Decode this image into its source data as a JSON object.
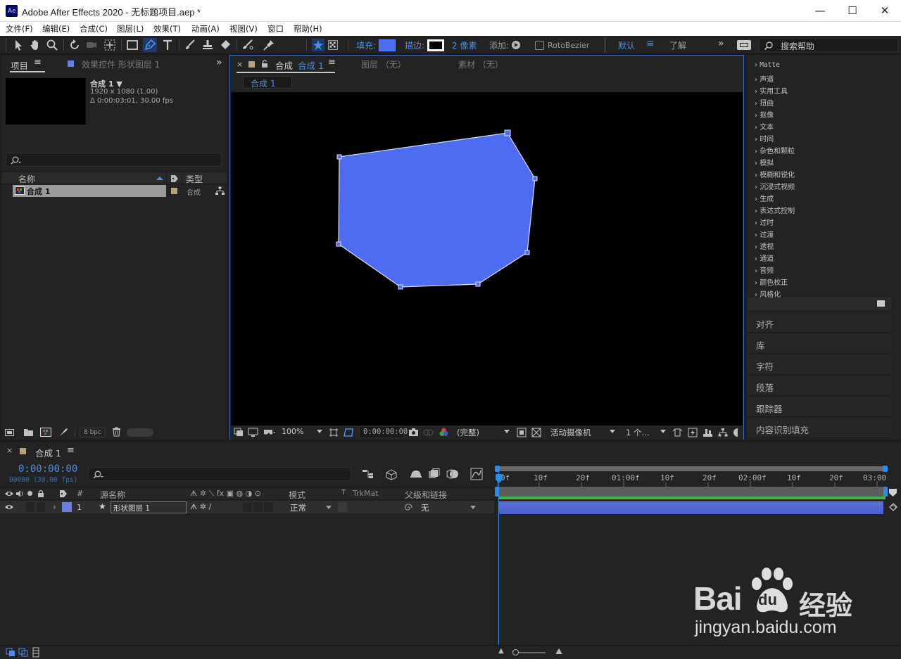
{
  "window": {
    "app_icon": "Ae",
    "title": "Adobe After Effects 2020 - 无标题项目.aep *",
    "minimize": "—",
    "maximize": "☐",
    "close": "✕"
  },
  "menu": {
    "items": [
      "文件(F)",
      "编辑(E)",
      "合成(C)",
      "图层(L)",
      "效果(T)",
      "动画(A)",
      "视图(V)",
      "窗口",
      "帮助(H)"
    ]
  },
  "toolbar": {
    "fill_label": "填充:",
    "fill_color": "#4d6cf2",
    "stroke_label": "描边:",
    "stroke_width": "2 像素",
    "add_label": "添加:",
    "rotobezier": "RotoBezier",
    "workspace_default": "默认",
    "workspace_learn": "了解",
    "search_placeholder": "搜索帮助"
  },
  "project": {
    "tab_label": "项目",
    "tab_effects": "效果控件 形状图层 1",
    "comp_name": "合成 1 ▼",
    "comp_res": "1920 x 1080 (1.00)",
    "comp_dur": "Δ 0:00:03:01, 30.00 fps",
    "search_placeholder": "",
    "col_name": "名称",
    "col_type": "类型",
    "items": [
      {
        "name": "合成 1",
        "type": "合成"
      }
    ],
    "bpc": "8 bpc"
  },
  "comp_viewer": {
    "tab_label": "合成",
    "tab_name": "合成 1",
    "tab_layer": "图层 （无）",
    "tab_footage": "素材 （无）",
    "sub_tab": "合成 1",
    "zoom": "100%",
    "timecode": "0:00:00:00",
    "quality": "(完整)",
    "camera": "活动摄像机",
    "views": "1 个..."
  },
  "effects": {
    "items": [
      "Matte",
      "声道",
      "实用工具",
      "扭曲",
      "抠像",
      "文本",
      "时间",
      "杂色和颗粒",
      "模拟",
      "模糊和锐化",
      "沉浸式视频",
      "生成",
      "表达式控制",
      "过时",
      "过渡",
      "透视",
      "通道",
      "音频",
      "颜色校正",
      "风格化"
    ]
  },
  "side_panels": [
    "对齐",
    "库",
    "字符",
    "段落",
    "跟踪器",
    "内容识别填充"
  ],
  "timeline": {
    "tab_name": "合成 1",
    "menu_icon": "≡",
    "timecode": "0:00:00:00",
    "frame_info": "00000 (30.00 fps)",
    "col_num": "#",
    "col_source": "源名称",
    "col_mode": "模式",
    "col_t": "T",
    "col_trkmat": "TrkMat",
    "col_parent": "父级和链接",
    "layers": [
      {
        "num": "1",
        "name": "形状图层 1",
        "mode": "正常",
        "parent": "无",
        "color": "#6b7ee0"
      }
    ],
    "ruler": [
      "0f",
      "10f",
      "20f",
      "01:00f",
      "10f",
      "20f",
      "02:00f",
      "10f",
      "20f",
      "03:00"
    ]
  },
  "watermark": {
    "brand": "Bai",
    "brand_du": "du",
    "brand_cn": "经验",
    "url": "jingyan.baidu.com"
  }
}
